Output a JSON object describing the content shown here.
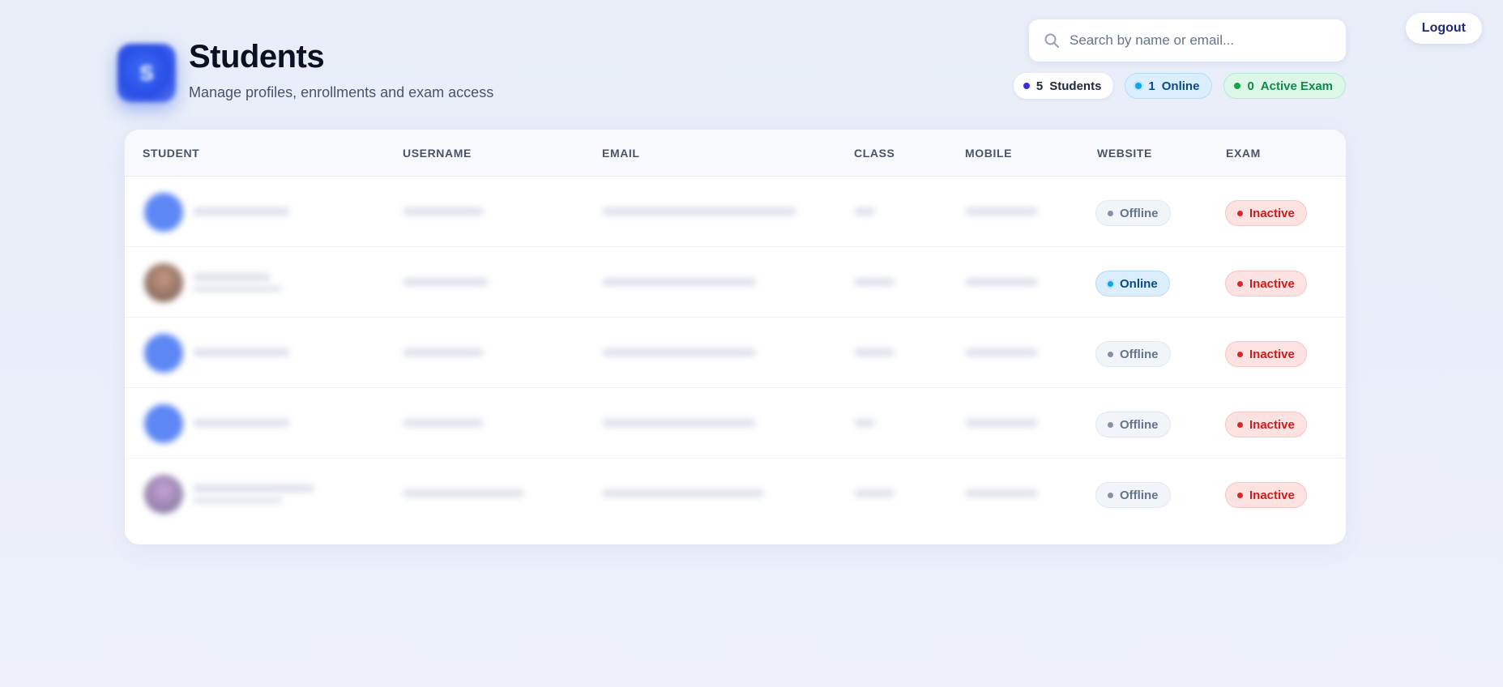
{
  "header": {
    "logo_letter": "S",
    "title": "Students",
    "subtitle": "Manage profiles, enrollments and exam access"
  },
  "logout_label": "Logout",
  "search": {
    "placeholder": "Search by name or email...",
    "value": ""
  },
  "stats": {
    "students_count": "5",
    "students_label": "Students",
    "online_count": "1",
    "online_label": "Online",
    "exam_count": "0",
    "exam_label": "Active Exam"
  },
  "table": {
    "columns": [
      "STUDENT",
      "USERNAME",
      "EMAIL",
      "CLASS",
      "MOBILE",
      "WEBSITE",
      "EXAM"
    ],
    "rows": [
      {
        "website": "Offline",
        "exam": "Inactive"
      },
      {
        "website": "Online",
        "exam": "Inactive"
      },
      {
        "website": "Offline",
        "exam": "Inactive"
      },
      {
        "website": "Offline",
        "exam": "Inactive"
      },
      {
        "website": "Offline",
        "exam": "Inactive"
      }
    ]
  },
  "colors": {
    "accent": "#3b2fd9",
    "online": "#0ea5e9",
    "active_exam": "#16a34a",
    "inactive": "#dc2626",
    "offline": "#8590a6"
  }
}
